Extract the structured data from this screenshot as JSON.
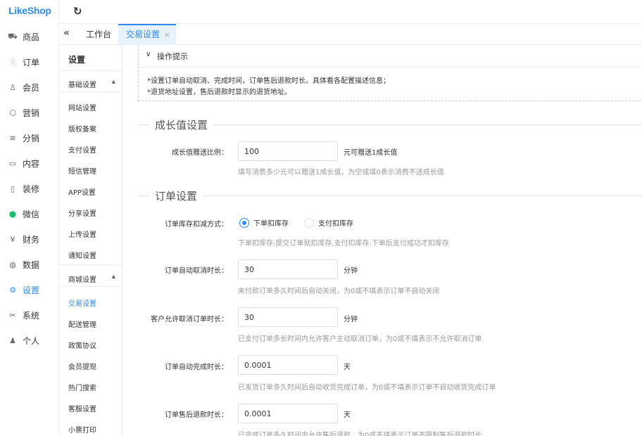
{
  "app": {
    "logo": "LikeShop"
  },
  "nav": {
    "items": [
      {
        "label": "商品",
        "icon": "cart-icon"
      },
      {
        "label": "订单",
        "icon": "bell-icon"
      },
      {
        "label": "会员",
        "icon": "user-icon"
      },
      {
        "label": "营销",
        "icon": "box-icon"
      },
      {
        "label": "分销",
        "icon": "layers-icon"
      },
      {
        "label": "内容",
        "icon": "picture-icon"
      },
      {
        "label": "装修",
        "icon": "phone-icon"
      },
      {
        "label": "微信",
        "icon": "wechat-icon"
      },
      {
        "label": "财务",
        "icon": "yen-icon"
      },
      {
        "label": "数据",
        "icon": "globe-icon"
      },
      {
        "label": "设置",
        "icon": "gear-icon",
        "active": true
      },
      {
        "label": "系统",
        "icon": "tools-icon"
      },
      {
        "label": "个人",
        "icon": "person-icon"
      }
    ]
  },
  "tabs": {
    "work": "工作台",
    "trade": "交易设置",
    "close": "×"
  },
  "sub": {
    "title": "设置",
    "group1": "基础设置",
    "group1_items": [
      "网站设置",
      "版权备案",
      "支付设置",
      "短信管理",
      "APP设置",
      "分享设置",
      "上传设置",
      "通知设置"
    ],
    "group2": "商城设置",
    "group2_items": [
      "交易设置",
      "配送管理",
      "政策协议",
      "会员提现",
      "热门搜索",
      "客服设置",
      "小票打印"
    ]
  },
  "tip": {
    "title": "操作提示",
    "lines": [
      "*设置订单自动取消、完成时间，订单售后退款时长。具体看各配置描述信息；",
      "*退货地址设置，售后退款时显示的退货地址。"
    ]
  },
  "growth": {
    "section": "成长值设置",
    "label": "成长值赠送比例：",
    "value": "100",
    "unit": "元可赠送1成长值",
    "help": "填写消费多少元可以赠送1成长值，为空或填0表示消费不送成长值"
  },
  "order": {
    "section": "订单设置",
    "stock_label": "订单库存扣减方式：",
    "stock_options": [
      "下单扣库存",
      "支付扣库存"
    ],
    "stock_help": "下单扣库存:提交订单就扣库存,支付扣库存:下单后支付成功才扣库存",
    "cancel_label": "订单自动取消时长：",
    "cancel_value": "30",
    "cancel_unit": "分钟",
    "cancel_help": "未付款订单多久时间后自动关闭，为0或不填表示订单不自动关闭",
    "user_cancel_label": "客户允许取消订单时长：",
    "user_cancel_value": "30",
    "user_cancel_unit": "分钟",
    "user_cancel_help": "已支付订单多长时间内允许客户主动取消订单，为0或不填表示不允许取消订单",
    "finish_label": "订单自动完成时长：",
    "finish_value": "0.0001",
    "finish_unit": "天",
    "finish_help": "已发货订单多久时间后自动收货完成订单，为0或不填表示订单不自动收货完成订单",
    "refund_label": "订单售后退款时长：",
    "refund_value": "0.0001",
    "refund_unit": "天",
    "refund_help": "已完成订单多久时间内允许售后退款，为0或不填表示订单不限制售后退款时长"
  }
}
